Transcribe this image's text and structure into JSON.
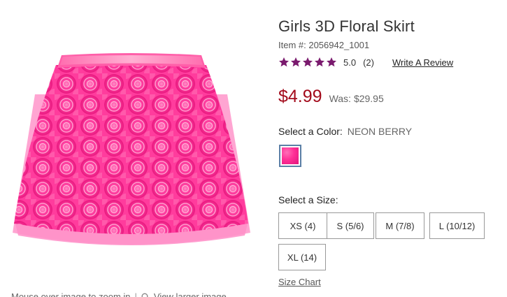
{
  "product": {
    "title": "Girls 3D Floral Skirt",
    "item_number": "Item #: 2056942_1001",
    "image_alt": "pink rosette tulle skirt"
  },
  "rating": {
    "value": "5.0",
    "count": "(2)",
    "stars": 5,
    "star_color": "#7a1a6e",
    "review_link": "Write A Review"
  },
  "price": {
    "sale": "$4.99",
    "was_label": "Was:",
    "was": "$29.95",
    "sale_color": "#a30b1c"
  },
  "color": {
    "label": "Select a Color:",
    "value": "NEON BERRY",
    "swatch_color": "#ff2f96"
  },
  "size": {
    "label": "Select a Size:",
    "options": [
      "XS (4)",
      "S (5/6)",
      "M (7/8)",
      "L (10/12)",
      "XL (14)"
    ]
  },
  "links": {
    "size_chart": "Size Chart"
  },
  "zoom": {
    "hint": "Mouse over image to zoom in",
    "separator": "|",
    "view_larger": "View larger image",
    "icon": "magnifier-icon"
  }
}
